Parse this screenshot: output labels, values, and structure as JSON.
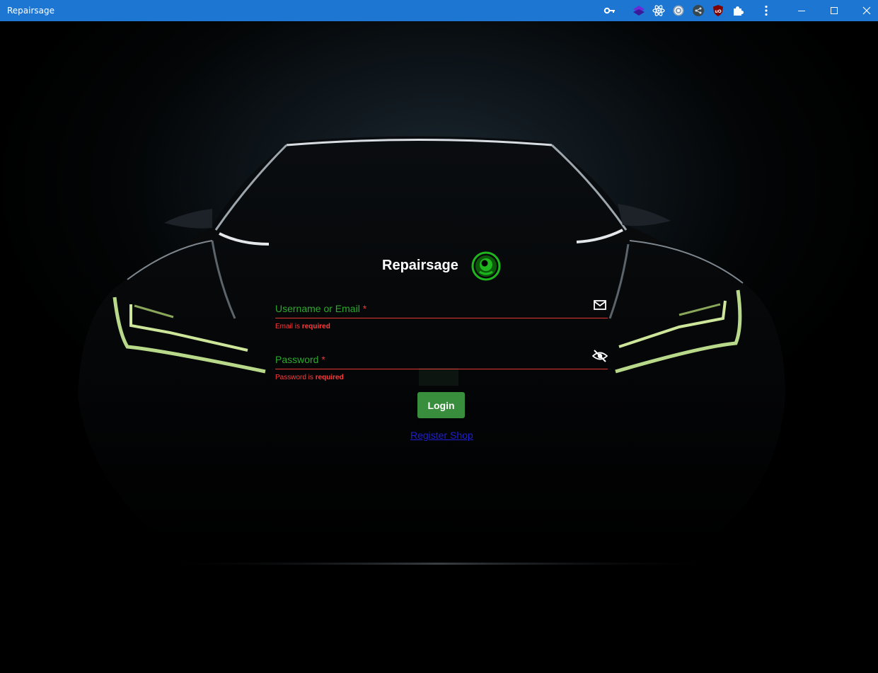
{
  "window": {
    "title": "Repairsage",
    "extensions": [
      "key-icon",
      "layers-extension-icon",
      "react-extension-icon",
      "target-extension-icon",
      "share-extension-icon",
      "ublock-extension-icon",
      "puzzle-extensions-icon"
    ],
    "colors": {
      "titlebar": "#1c76d2"
    }
  },
  "login": {
    "brand": "Repairsage",
    "username": {
      "label": "Username or Email",
      "required_mark": "*",
      "error_prefix": "Email is",
      "error_emphasis": "required"
    },
    "password": {
      "label": "Password",
      "required_mark": "*",
      "error_prefix": "Password is",
      "error_emphasis": "required"
    },
    "login_button": "Login",
    "register_link": "Register Shop",
    "colors": {
      "accent": "#2ea82e",
      "error": "#e53935",
      "button": "#388e3c",
      "link": "#1f1fd6"
    }
  }
}
